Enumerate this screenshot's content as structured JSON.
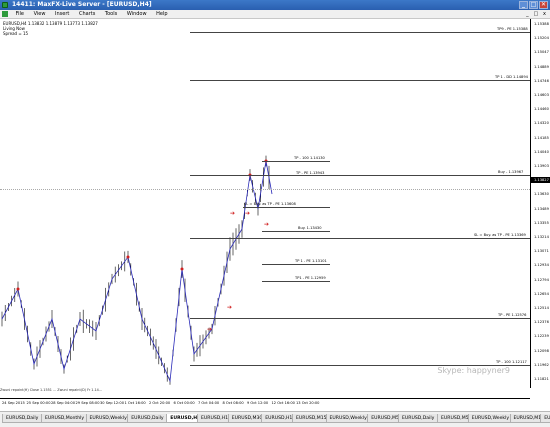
{
  "window": {
    "title": "14411: MaxFX-Live Server - [EURUSD,H4]",
    "buttons": [
      "_",
      "□",
      "✕"
    ]
  },
  "menu": {
    "items": [
      "File",
      "View",
      "Insert",
      "Charts",
      "Tools",
      "Window",
      "Help"
    ],
    "mdi_buttons": [
      "_",
      "□",
      "x"
    ]
  },
  "chart": {
    "info_line1": "EURUSD,H4  1.13832 1.13879 1.13773 1.13827",
    "info_line2": "Living Now",
    "info_line3": "Spread = 15",
    "current_price": "1.13827",
    "watermark": "Skype:  happyner9",
    "indicator_legend": "Zwuni repaint(H) Close 1.1551 ... Zwuni repaint(D) Fr 1.14...",
    "price_ticks": [
      "1.15388",
      "1.15204",
      "1.15047",
      "1.14889",
      "1.14746",
      "1.14603",
      "1.14460",
      "1.14320",
      "1.14185",
      "1.14040",
      "1.13903",
      "1.13827",
      "1.13630",
      "1.13489",
      "1.13355",
      "1.13214",
      "1.13071",
      "1.12934",
      "1.12794",
      "1.12654",
      "1.12514",
      "1.12376",
      "1.12239",
      "1.12098",
      "1.11962",
      "1.11821"
    ],
    "time_ticks": [
      "24 Sep 2015",
      "25 Sep 00:00",
      "28 Sep 04:00",
      "29 Sep 08:00",
      "30 Sep 12:00",
      "1 Oct 16:00",
      "2 Oct 20:00",
      "6 Oct 00:00",
      "7 Oct 04:00",
      "8 Oct 08:00",
      "9 Oct 12:00",
      "12 Oct 16:00",
      "13 Oct 20:00"
    ],
    "levels": [
      {
        "label": "TP9 - PE 1.15388"
      },
      {
        "label": "TP 1 - DD 1.14894"
      },
      {
        "label": "TP - 100 1.14130"
      },
      {
        "label": "TP - PE 1.13943"
      },
      {
        "label": "Buy - 1.13967"
      },
      {
        "label": "SL = Buy. as TP - PE 1.13608"
      },
      {
        "label": "Buy.  1.13430"
      },
      {
        "label": "SL = Buy. as TP - PE 1.13369"
      },
      {
        "label": "TP 1 - PE 1.13101"
      },
      {
        "label": "TP1 - PE 1.12959"
      },
      {
        "label": "TP - PE 1.12576"
      },
      {
        "label": "TP - 100 1.12117"
      }
    ]
  },
  "tabs": [
    "EURUSD,Daily",
    "EURUSD,Monthly",
    "EURUSD,Weekly",
    "EURUSD,Daily",
    "EURUSD,H4",
    "EURUSD,H1",
    "EURUSD,M30",
    "EURUSD,H1",
    "EURUSD,M15",
    "EURUSD,Weekly",
    "EURUSD,M5",
    "EURUSD,Daily",
    "EURUSD,M5",
    "EURUSD,Weekly",
    "EURUSD,M1",
    "EURUSD,H1"
  ],
  "active_tab_index": 4
}
